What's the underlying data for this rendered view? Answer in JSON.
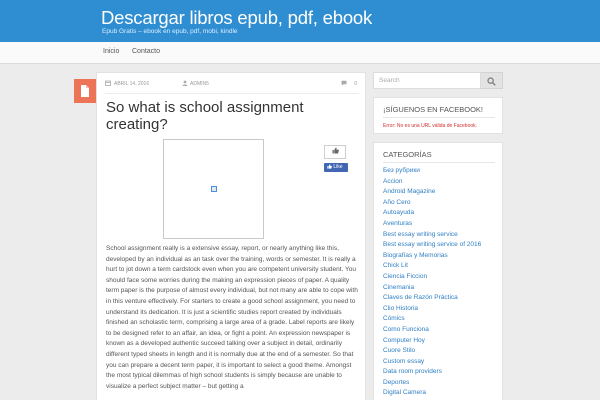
{
  "site": {
    "title": "Descargar libros epub, pdf, ebook",
    "tagline": "Epub Gratis – ebook en epub, pdf, mobi, kindle"
  },
  "nav": {
    "items": [
      "Inicio",
      "Contacto"
    ]
  },
  "post": {
    "date": "ABRIL 14, 2016",
    "author": "ADMIN5",
    "comment_count": "0",
    "title": "So what is school assignment creating?",
    "like_label": "Like",
    "body": "School assignment really is a extensive essay, report, or nearly anything like this, developed by an individual as an task over the training, words or semester. It is really a hurt to jot down a term cardstock even when you are competent university student. You should face some worries during the making an expression pieces of paper. A quality term paper is the purpose of almost every individual, but not many are able to cope with in this venture effectively. For starters to create a good school assignment, you need to understand its dedication. It is just a scientific studies report created by individuals finished an scholastic term, comprising a large area of a grade. Label reports are likely to be designed refer to an affair, an idea, or fight a point. An expression newspaper is known as a developed authentic succeed talking over a subject in detail, ordinarily different typed sheets in length and it is normally due at the end of a semester. So that you can prepare a decent term paper, it is important to select a good theme. Amongst the most typical dilemmas of high school students is simply because are unable to visualize a perfect subject matter – but getting a"
  },
  "sidebar": {
    "search_placeholder": "Search",
    "facebook": {
      "title": "¡SÍGUENOS EN FACEBOOK!",
      "error": "Error: No es una URL válida de Facebook."
    },
    "categories": {
      "title": "CATEGORÍAS",
      "items": [
        "Без рубрики",
        "Accion",
        "Android Magazine",
        "Año Cero",
        "Autoayuda",
        "Aventuras",
        "Best essay writing service",
        "Best essay writing service of 2016",
        "Biografías y Memorias",
        "Chick Lit",
        "Ciencia Ficcion",
        "Cinemania",
        "Claves de Razón Práctica",
        "Clio Historia",
        "Cómics",
        "Como Funciona",
        "Computer Hoy",
        "Cuore Stilo",
        "Custom essay",
        "Data room providers",
        "Deportes",
        "Digital Camera"
      ]
    }
  },
  "colors": {
    "header": "#2f8ed2",
    "badge": "#ee7458",
    "link": "#2f7fc4",
    "error": "#d3302f"
  }
}
